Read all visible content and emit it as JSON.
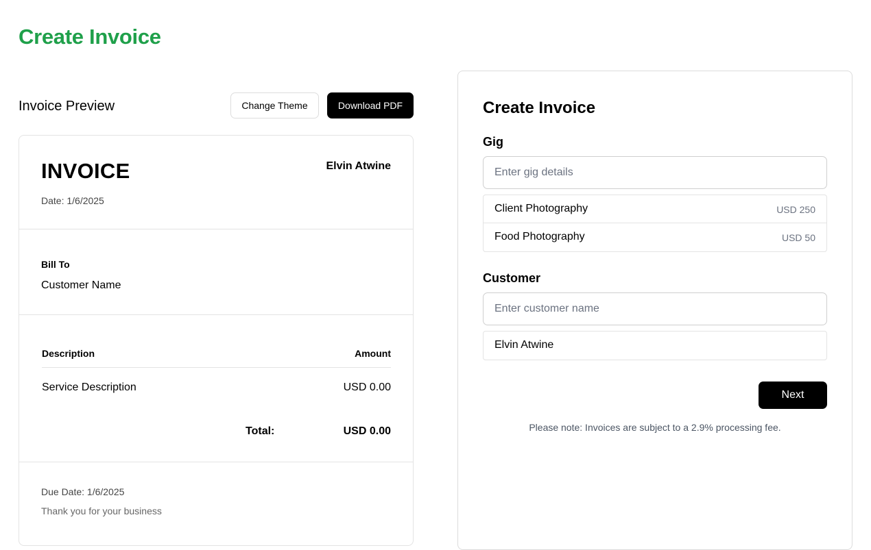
{
  "page": {
    "title": "Create Invoice",
    "title_color": "#1fa04a"
  },
  "preview": {
    "title": "Invoice Preview",
    "change_theme_label": "Change Theme",
    "download_pdf_label": "Download PDF",
    "invoice": {
      "heading": "INVOICE",
      "issuer_name": "Elvin Atwine",
      "date": "Date: 1/6/2025",
      "bill_to_label": "Bill To",
      "bill_to_name": "Customer Name",
      "columns": {
        "description": "Description",
        "amount": "Amount"
      },
      "items": [
        {
          "description": "Service Description",
          "amount": "USD 0.00"
        }
      ],
      "total_label": "Total:",
      "total_value": "USD 0.00",
      "due_date": "Due Date: 1/6/2025",
      "thanks": "Thank you for your business"
    }
  },
  "form": {
    "title": "Create Invoice",
    "gig": {
      "label": "Gig",
      "placeholder": "Enter gig details",
      "value": "",
      "options": [
        {
          "name": "Client Photography",
          "price": "USD 250"
        },
        {
          "name": "Food Photography",
          "price": "USD 50"
        }
      ]
    },
    "customer": {
      "label": "Customer",
      "placeholder": "Enter customer name",
      "value": "",
      "options": [
        {
          "name": "Elvin Atwine"
        }
      ]
    },
    "next_label": "Next",
    "note": "Please note: Invoices are subject to a 2.9% processing fee."
  }
}
